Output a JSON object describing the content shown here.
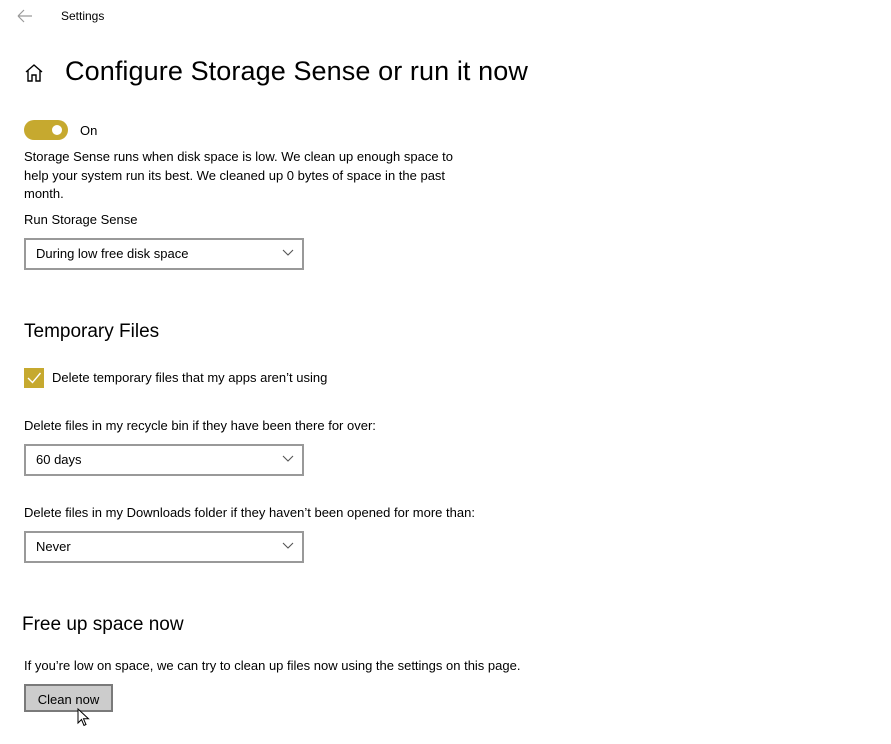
{
  "header": {
    "back_icon": "arrow-left-icon",
    "app_title": "Settings"
  },
  "page": {
    "home_icon": "home-icon",
    "title": "Configure Storage Sense or run it now"
  },
  "storage_sense": {
    "toggle_state": "On",
    "toggle_on": true,
    "description": "Storage Sense runs when disk space is low. We clean up enough space to help your system run its best. We cleaned up 0 bytes of space in the past month.",
    "run_label": "Run Storage Sense",
    "run_value": "During low free disk space"
  },
  "temporary_files": {
    "heading": "Temporary Files",
    "delete_temp_label": "Delete temporary files that my apps aren’t using",
    "delete_temp_checked": true,
    "recycle_label": "Delete files in my recycle bin if they have been there for over:",
    "recycle_value": "60 days",
    "downloads_label": "Delete files in my Downloads folder if they haven’t been opened for more than:",
    "downloads_value": "Never"
  },
  "free_up": {
    "heading": "Free up space now",
    "description": "If you’re low on space, we can try to clean up files now using the settings on this page.",
    "button_label": "Clean now"
  },
  "colors": {
    "accent": "#c6a92f",
    "button_bg": "#cccccc",
    "select_border": "#999999"
  }
}
